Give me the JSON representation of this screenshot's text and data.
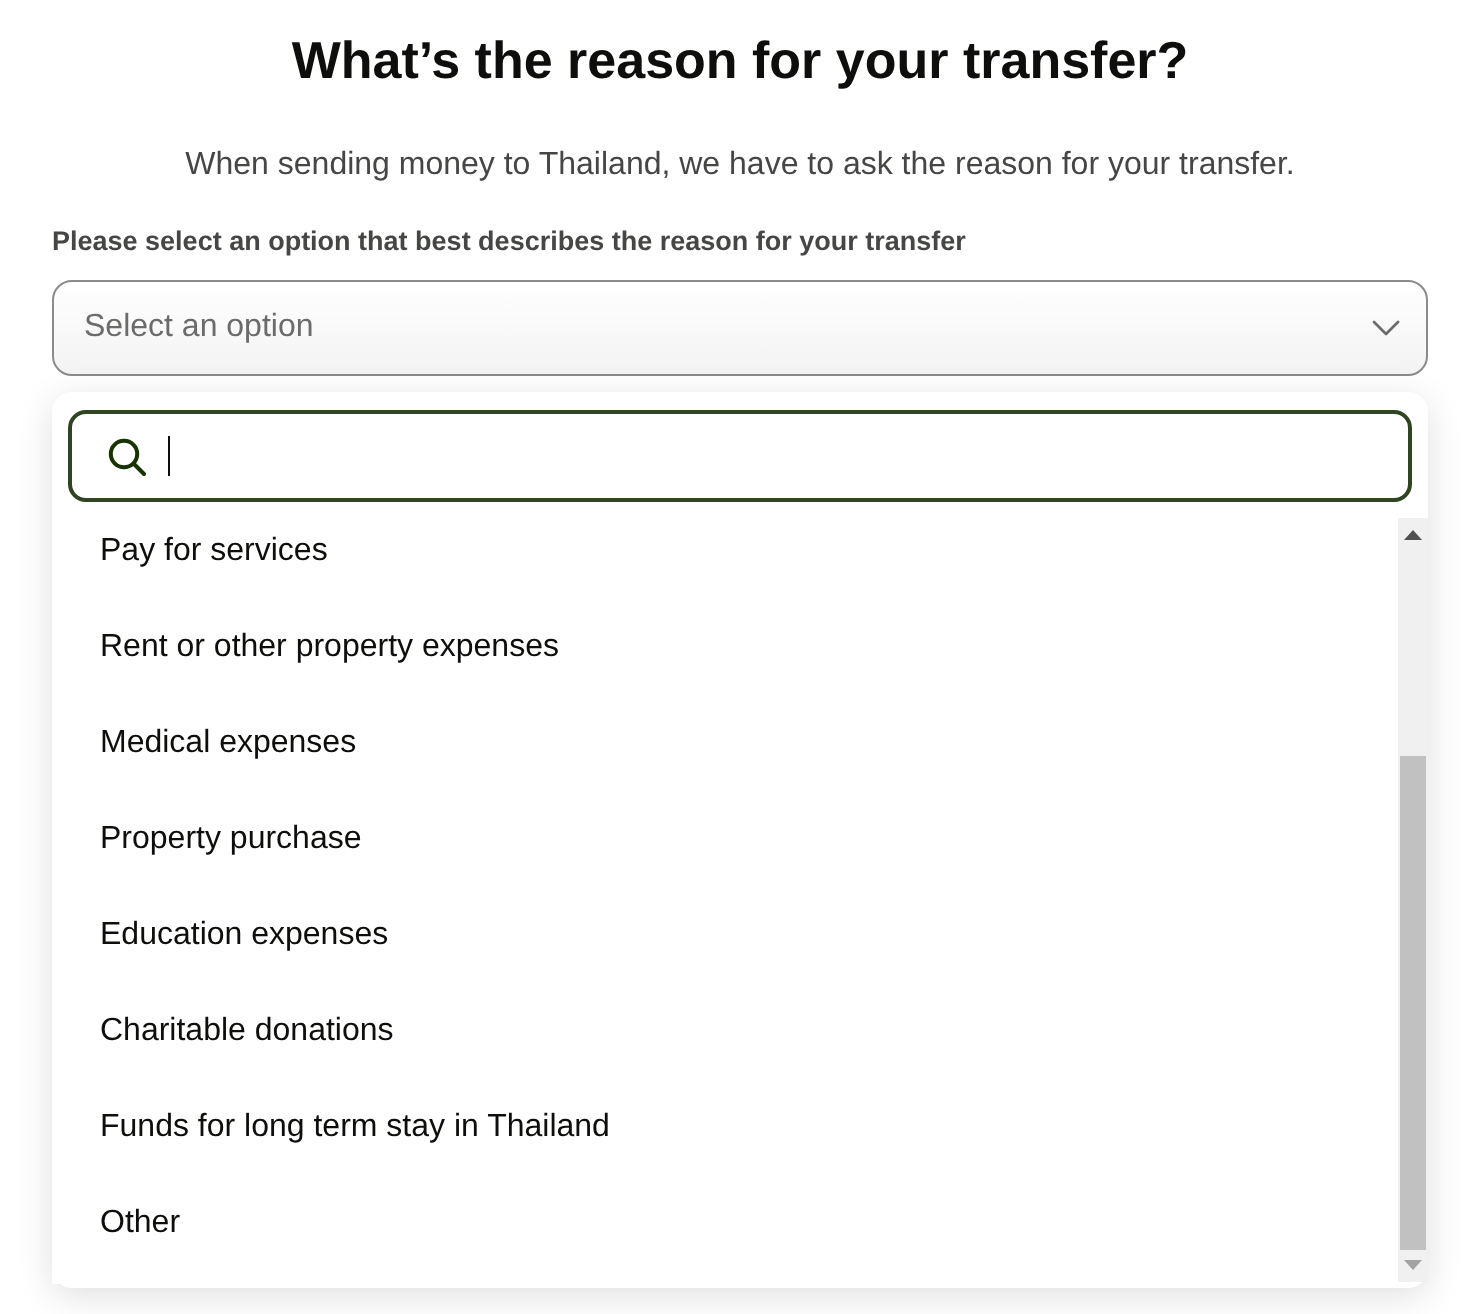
{
  "heading": "What’s the reason for your transfer?",
  "intro": "When sending money to Thailand, we have to ask the reason for your transfer.",
  "field": {
    "label": "Please select an option that best describes the reason for your transfer",
    "placeholder": "Select an option",
    "expanded": true
  },
  "search": {
    "focused": true
  },
  "options": [
    {
      "label": "Pay for services",
      "selected": false
    },
    {
      "label": "Rent or other property expenses",
      "selected": false
    },
    {
      "label": "Medical expenses",
      "selected": false
    },
    {
      "label": "Property purchase",
      "selected": false
    },
    {
      "label": "Education expenses",
      "selected": false
    },
    {
      "label": "Charitable donations",
      "selected": false
    },
    {
      "label": "Funds for long term stay in Thailand",
      "selected": false
    },
    {
      "label": "Other",
      "selected": false
    }
  ]
}
